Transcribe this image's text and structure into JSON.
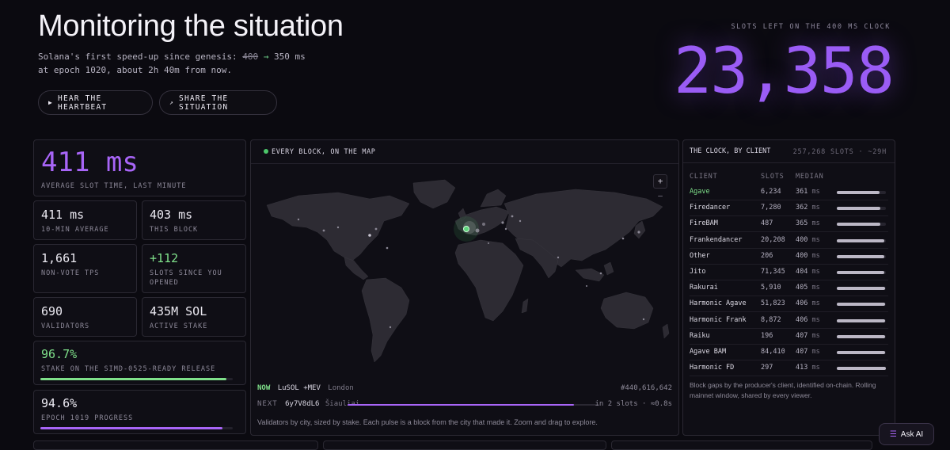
{
  "header": {
    "title": "Monitoring the situation",
    "subtitle_prefix": "Solana's first speed-up since genesis: ",
    "subtitle_old": "400",
    "subtitle_arrow": "→",
    "subtitle_suffix": " 350 ms at epoch 1020, about 2h 40m from now.",
    "buttons": {
      "heartbeat_icon": "play-icon",
      "heartbeat": "HEAR THE HEARTBEAT",
      "share_icon": "arrow-up-right-icon",
      "share": "SHARE THE SITUATION"
    }
  },
  "clock": {
    "label": "SLOTS LEFT ON THE 400 MS CLOCK",
    "value": "23,358"
  },
  "stats": {
    "avg_slot": {
      "value": "411 ms",
      "label": "AVERAGE SLOT TIME, LAST MINUTE"
    },
    "ten_min": {
      "value": "411 ms",
      "label": "10-MIN AVERAGE"
    },
    "this_block": {
      "value": "403 ms",
      "label": "THIS BLOCK"
    },
    "tps": {
      "value": "1,661",
      "label": "NON-VOTE TPS"
    },
    "since_opened": {
      "value": "+112",
      "label": "SLOTS SINCE YOU OPENED"
    },
    "validators": {
      "value": "690",
      "label": "VALIDATORS"
    },
    "stake": {
      "value": "435M SOL",
      "label": "ACTIVE STAKE"
    },
    "simd": {
      "value": "96.7%",
      "label": "STAKE ON THE SIMD-0525-READY RELEASE",
      "fraction": 0.967
    },
    "epoch": {
      "value": "94.6%",
      "label": "EPOCH 1019 PROGRESS",
      "fraction": 0.946
    }
  },
  "map": {
    "title": "EVERY BLOCK, ON THE MAP",
    "zoom_in": "+",
    "zoom_out": "−",
    "now_label": "NOW",
    "now_client": "LuSOL +MEV",
    "now_city": "London",
    "now_slot": "#440,616,642",
    "next_label": "NEXT",
    "next_id": "6y7V8dL6",
    "next_city": "Šiauliai",
    "next_eta": "in 2 slots · ≈0.8s",
    "next_progress": 0.9,
    "caption": "Validators by city, sized by stake. Each pulse is a block from the city that made it. Zoom and drag to explore."
  },
  "clients": {
    "title": "THE CLOCK, BY CLIENT",
    "meta": "257,268 SLOTS · ~29H",
    "columns": [
      "CLIENT",
      "SLOTS",
      "MEDIAN"
    ],
    "unit": "ms",
    "rows": [
      {
        "name": "Agave",
        "slots": "6,234",
        "median": "361",
        "level": 0.87,
        "highlight": true
      },
      {
        "name": "Firedancer",
        "slots": "7,280",
        "median": "362",
        "level": 0.88
      },
      {
        "name": "FireBAM",
        "slots": "487",
        "median": "365",
        "level": 0.88
      },
      {
        "name": "Frankendancer",
        "slots": "20,208",
        "median": "400",
        "level": 0.97
      },
      {
        "name": "Other",
        "slots": "206",
        "median": "400",
        "level": 0.97
      },
      {
        "name": "Jito",
        "slots": "71,345",
        "median": "404",
        "level": 0.97
      },
      {
        "name": "Rakurai",
        "slots": "5,910",
        "median": "405",
        "level": 0.98
      },
      {
        "name": "Harmonic Agave",
        "slots": "51,823",
        "median": "406",
        "level": 0.98
      },
      {
        "name": "Harmonic Frank",
        "slots": "8,872",
        "median": "406",
        "level": 0.98
      },
      {
        "name": "Raiku",
        "slots": "196",
        "median": "407",
        "level": 0.98
      },
      {
        "name": "Agave BAM",
        "slots": "84,410",
        "median": "407",
        "level": 0.98
      },
      {
        "name": "Harmonic FD",
        "slots": "297",
        "median": "413",
        "level": 1.0
      }
    ],
    "caption": "Block gaps by the producer's client, identified on-chain. Rolling mainnet window, shared by every viewer."
  },
  "ask_ai": {
    "icon": "stack-icon",
    "label": "Ask AI"
  },
  "colors": {
    "accent": "#a865f7",
    "green": "#7fe08a",
    "bg": "#0b0a10"
  }
}
